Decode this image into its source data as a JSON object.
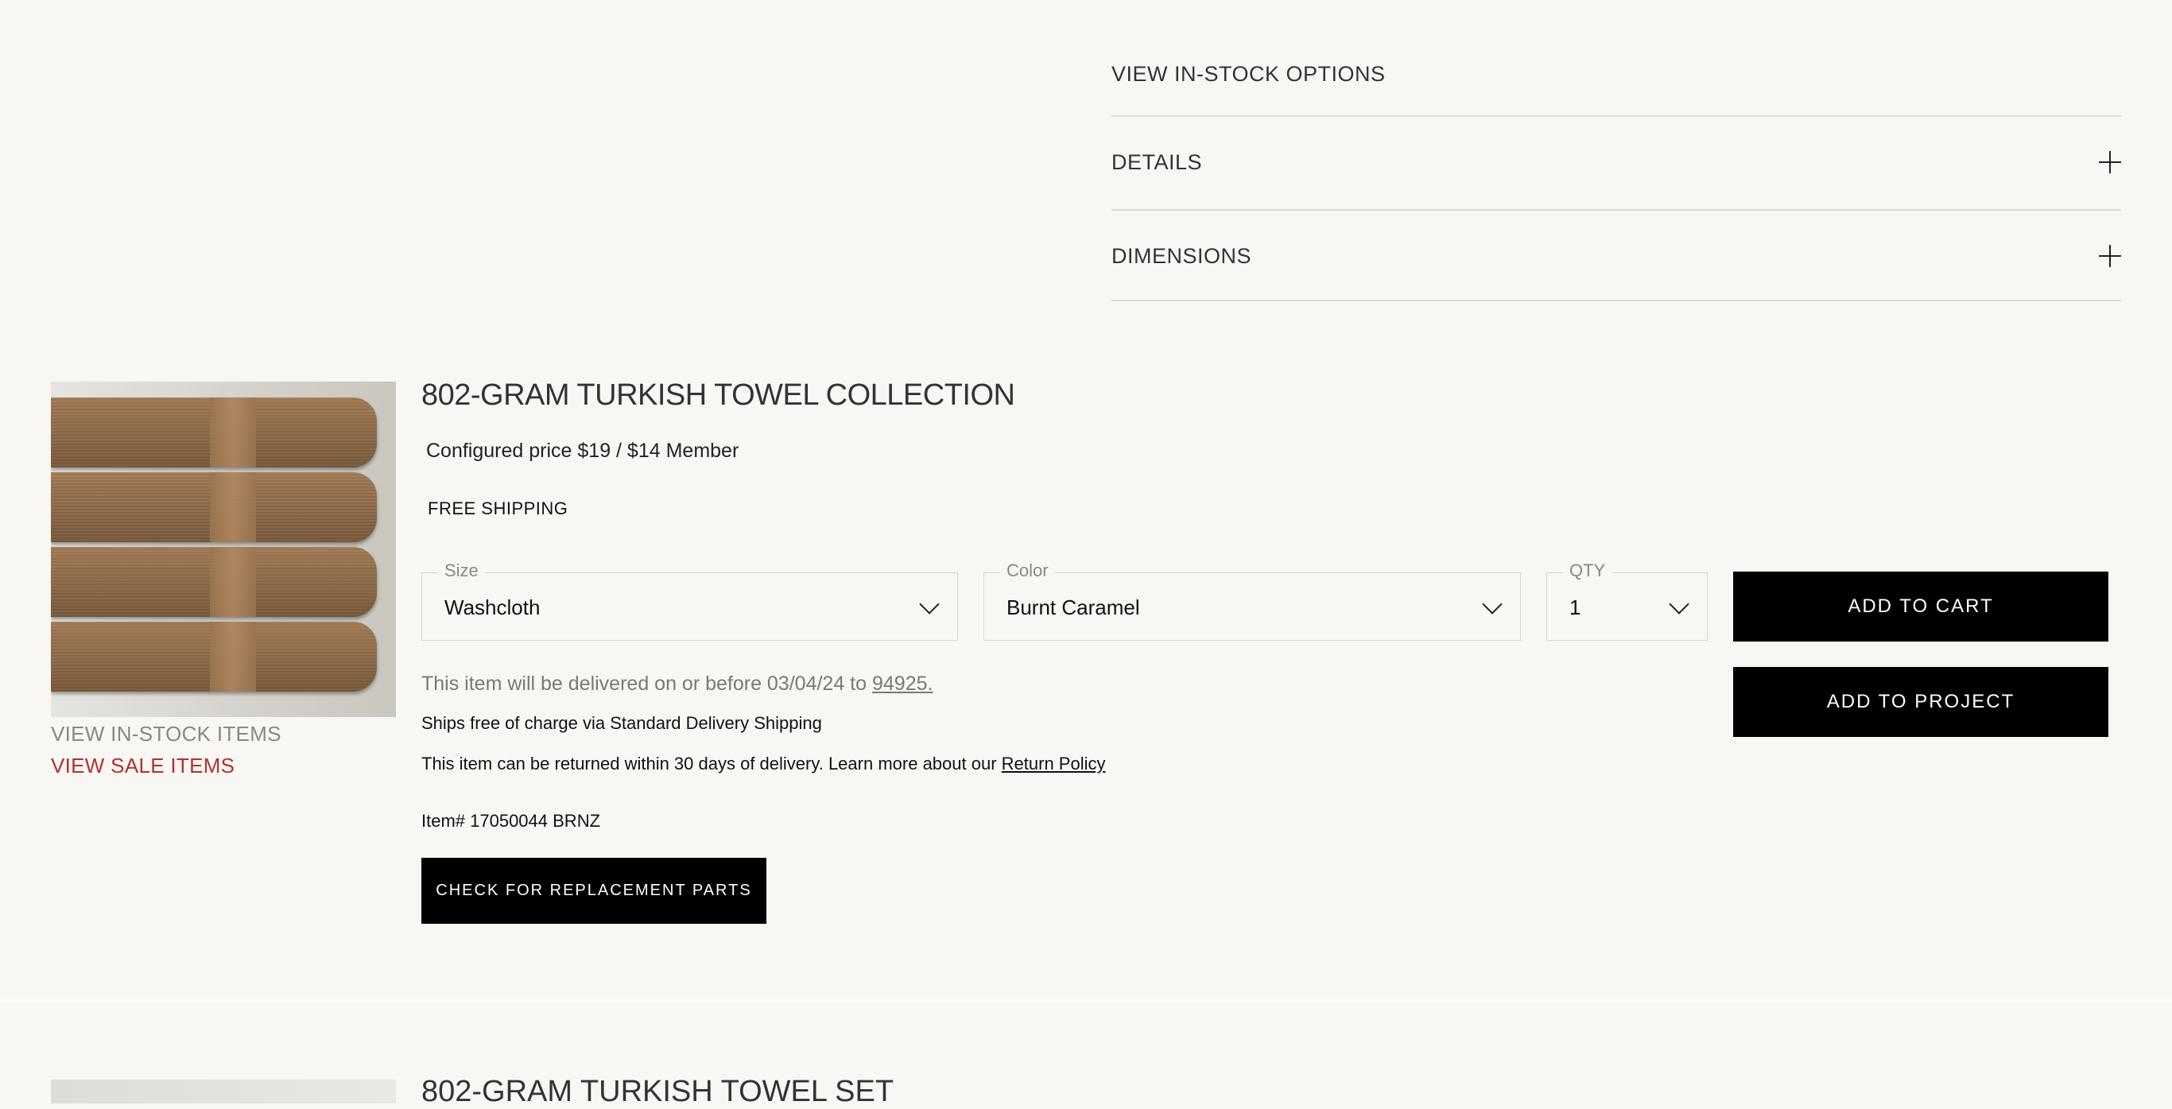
{
  "accordion": {
    "in_stock_link": "VIEW IN-STOCK OPTIONS",
    "details_label": "DETAILS",
    "dimensions_label": "DIMENSIONS"
  },
  "product": {
    "title": "802-GRAM TURKISH TOWEL COLLECTION",
    "price": "Configured price $19 / $14 Member",
    "shipping_tag": "FREE SHIPPING",
    "view_in_stock": "VIEW IN-STOCK ITEMS",
    "view_sale": "VIEW SALE ITEMS",
    "size": {
      "legend": "Size",
      "value": "Washcloth"
    },
    "color": {
      "legend": "Color",
      "value": "Burnt Caramel"
    },
    "qty": {
      "legend": "QTY",
      "value": "1"
    },
    "add_to_cart": "ADD TO CART",
    "add_to_project": "ADD TO PROJECT",
    "delivery_text": "This item will be delivered on or before 03/04/24 to ",
    "delivery_zip": "94925.",
    "ships_text": "Ships free of charge via Standard Delivery Shipping",
    "returns_text": "This item can be returned within 30 days of delivery. Learn more about our ",
    "return_policy_link": "Return Policy",
    "item_number": "Item# 17050044 BRNZ",
    "replacement_parts": "CHECK FOR REPLACEMENT PARTS"
  },
  "next_product": {
    "title": "802-GRAM TURKISH TOWEL SET"
  },
  "colors": {
    "background": "#f8f7f4",
    "button": "#000000",
    "sale_link": "#b3312e"
  }
}
